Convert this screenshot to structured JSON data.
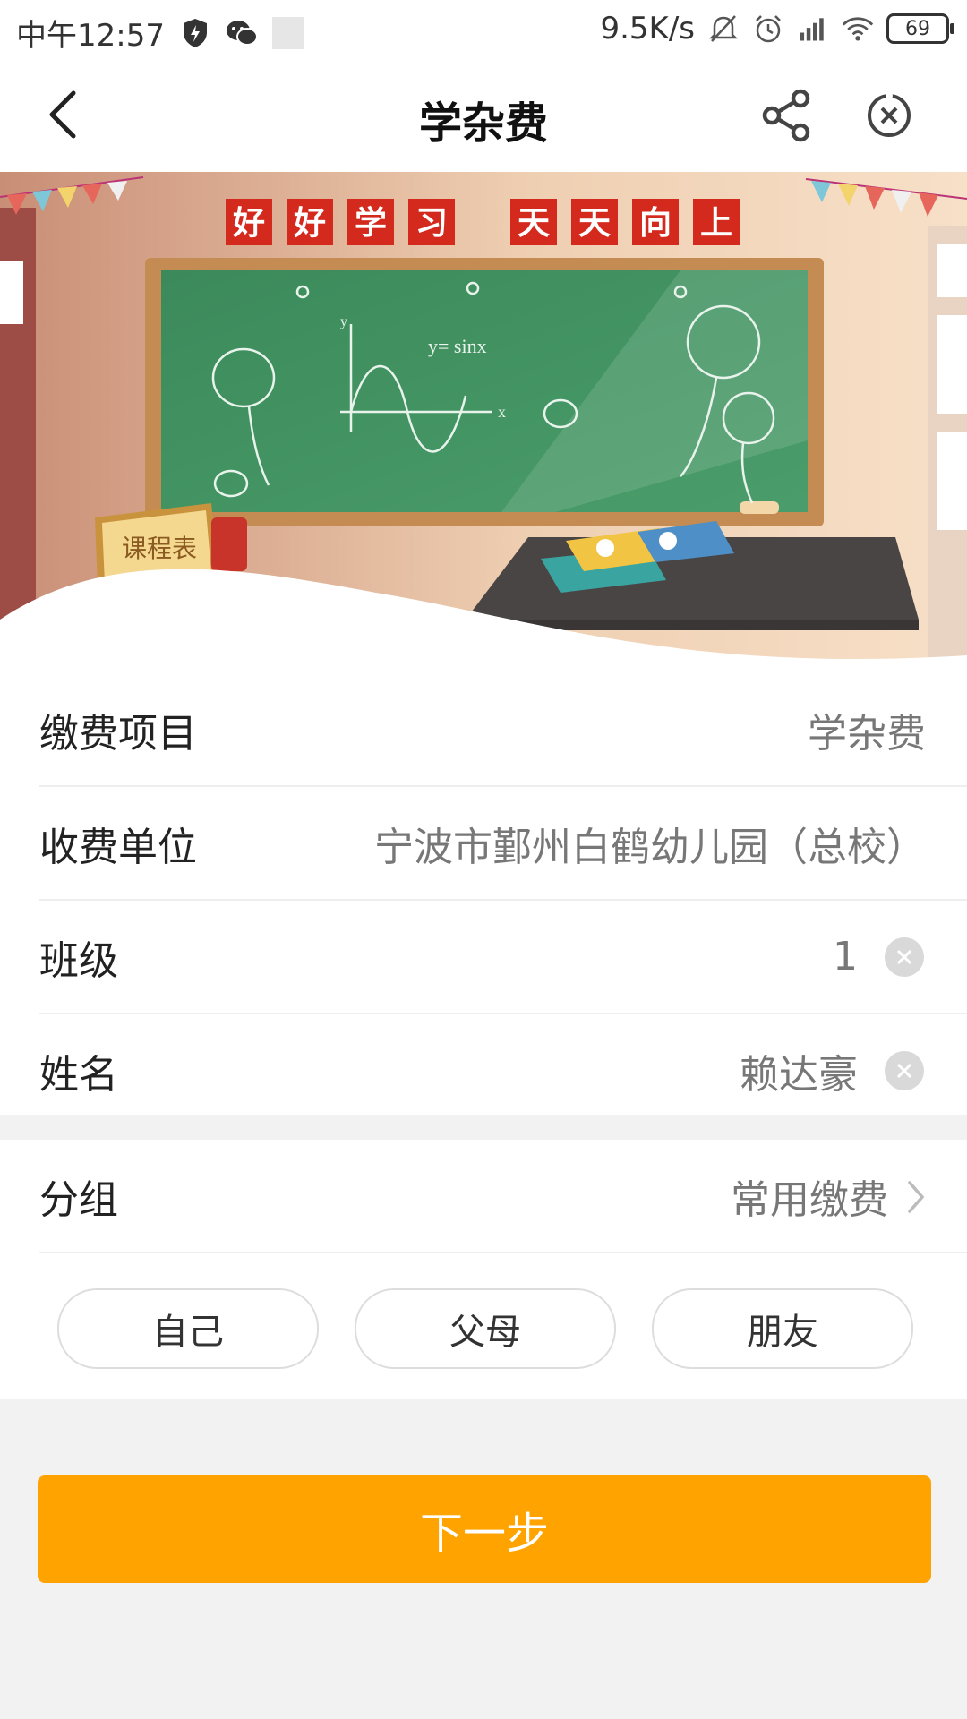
{
  "status_bar": {
    "time": "中午12:57",
    "net_speed": "9.5K/s",
    "battery": "69",
    "icons": [
      "shield-icon",
      "wechat-icon",
      "mute-icon",
      "alarm-icon",
      "signal-icon",
      "wifi-icon",
      "battery-icon"
    ]
  },
  "nav": {
    "title": "学杂费",
    "icons": [
      "back-icon",
      "share-icon",
      "close-icon"
    ]
  },
  "banner": {
    "slogan_left": [
      "好",
      "好",
      "学",
      "习"
    ],
    "slogan_right": [
      "天",
      "天",
      "向",
      "上"
    ],
    "formula": "y= sinx",
    "sign": "课程表"
  },
  "form": {
    "rows": [
      {
        "label": "缴费项目",
        "value": "学杂费"
      },
      {
        "label": "收费单位",
        "value": "宁波市鄞州白鹤幼儿园（总校）"
      },
      {
        "label": "班级",
        "value": "1"
      },
      {
        "label": "姓名",
        "value": "赖达豪"
      }
    ]
  },
  "group": {
    "label": "分组",
    "value": "常用缴费",
    "chips": [
      "自己",
      "父母",
      "朋友"
    ]
  },
  "next_button": "下一步",
  "colors": {
    "accent": "#ffa300",
    "banner_red": "#d42a1e",
    "board_green": "#3d8a5a"
  }
}
